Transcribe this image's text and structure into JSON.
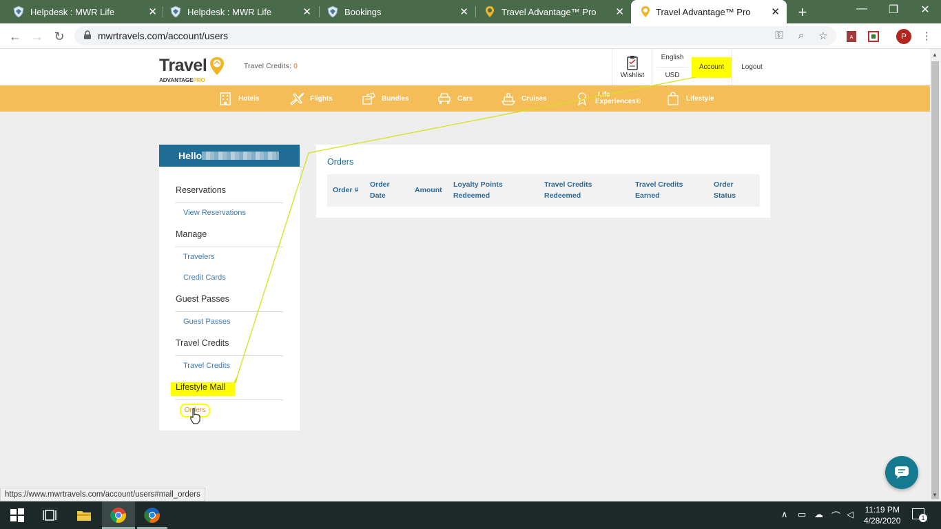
{
  "browser": {
    "tabs": [
      {
        "title": "Helpdesk : MWR Life",
        "active": false
      },
      {
        "title": "Helpdesk : MWR Life",
        "active": false
      },
      {
        "title": "Bookings",
        "active": false
      },
      {
        "title": "Travel Advantage™ Pro",
        "active": false
      },
      {
        "title": "Travel Advantage™ Pro",
        "active": true
      }
    ],
    "close_glyph": "✕",
    "new_tab_glyph": "+",
    "url": "mwrtravels.com/account/users",
    "profile_initial": "P",
    "status_url": "https://www.mwrtravels.com/account/users#mall_orders",
    "colors": {
      "tab_strip": "#4a6b4a",
      "active_tab": "#ffffff"
    }
  },
  "header": {
    "logo_main": "Travel",
    "logo_sub_a": "ADVANTAGE",
    "logo_sub_b": "PRO",
    "credits_label": "Travel Credits:",
    "credits_value": "0",
    "wishlist_label": "Wishlist",
    "language": "English",
    "currency": "USD",
    "account_label": "Account",
    "logout_label": "Logout"
  },
  "nav": {
    "items": [
      {
        "label": "Hotels",
        "icon": "hotel-icon"
      },
      {
        "label": "Flights",
        "icon": "airplane-icon"
      },
      {
        "label": "Bundles",
        "icon": "bundle-icon"
      },
      {
        "label": "Cars",
        "icon": "car-icon"
      },
      {
        "label": "Cruises",
        "icon": "ship-icon"
      },
      {
        "label": "Life",
        "label2": "Experiences®",
        "icon": "experience-icon"
      },
      {
        "label": "Lifestyle",
        "icon": "shopping-bag-icon"
      }
    ],
    "color": "#f4bd57"
  },
  "sidebar": {
    "greeting": "Hello",
    "sections": [
      {
        "title": "Reservations",
        "links": [
          "View Reservations"
        ]
      },
      {
        "title": "Manage",
        "links": [
          "Travelers",
          "Credit Cards"
        ]
      },
      {
        "title": "Guest Passes",
        "links": [
          "Guest Passes"
        ]
      },
      {
        "title": "Travel Credits",
        "links": [
          "Travel Credits"
        ]
      },
      {
        "title": "Lifestyle Mall",
        "links": [
          "Orders"
        ]
      }
    ],
    "header_color": "#1f6d94",
    "highlight_color": "#ffff00"
  },
  "orders": {
    "title": "Orders",
    "columns": [
      [
        "Order #"
      ],
      [
        "Order",
        "Date"
      ],
      [
        "Amount"
      ],
      [
        "Loyalty Points",
        "Redeemed"
      ],
      [
        "Travel Credits",
        "Redeemed"
      ],
      [
        "Travel Credits",
        "Earned"
      ],
      [
        "Order",
        "Status"
      ]
    ]
  },
  "taskbar": {
    "time": "11:19 PM",
    "date": "4/28/2020",
    "notification_count": "1"
  }
}
